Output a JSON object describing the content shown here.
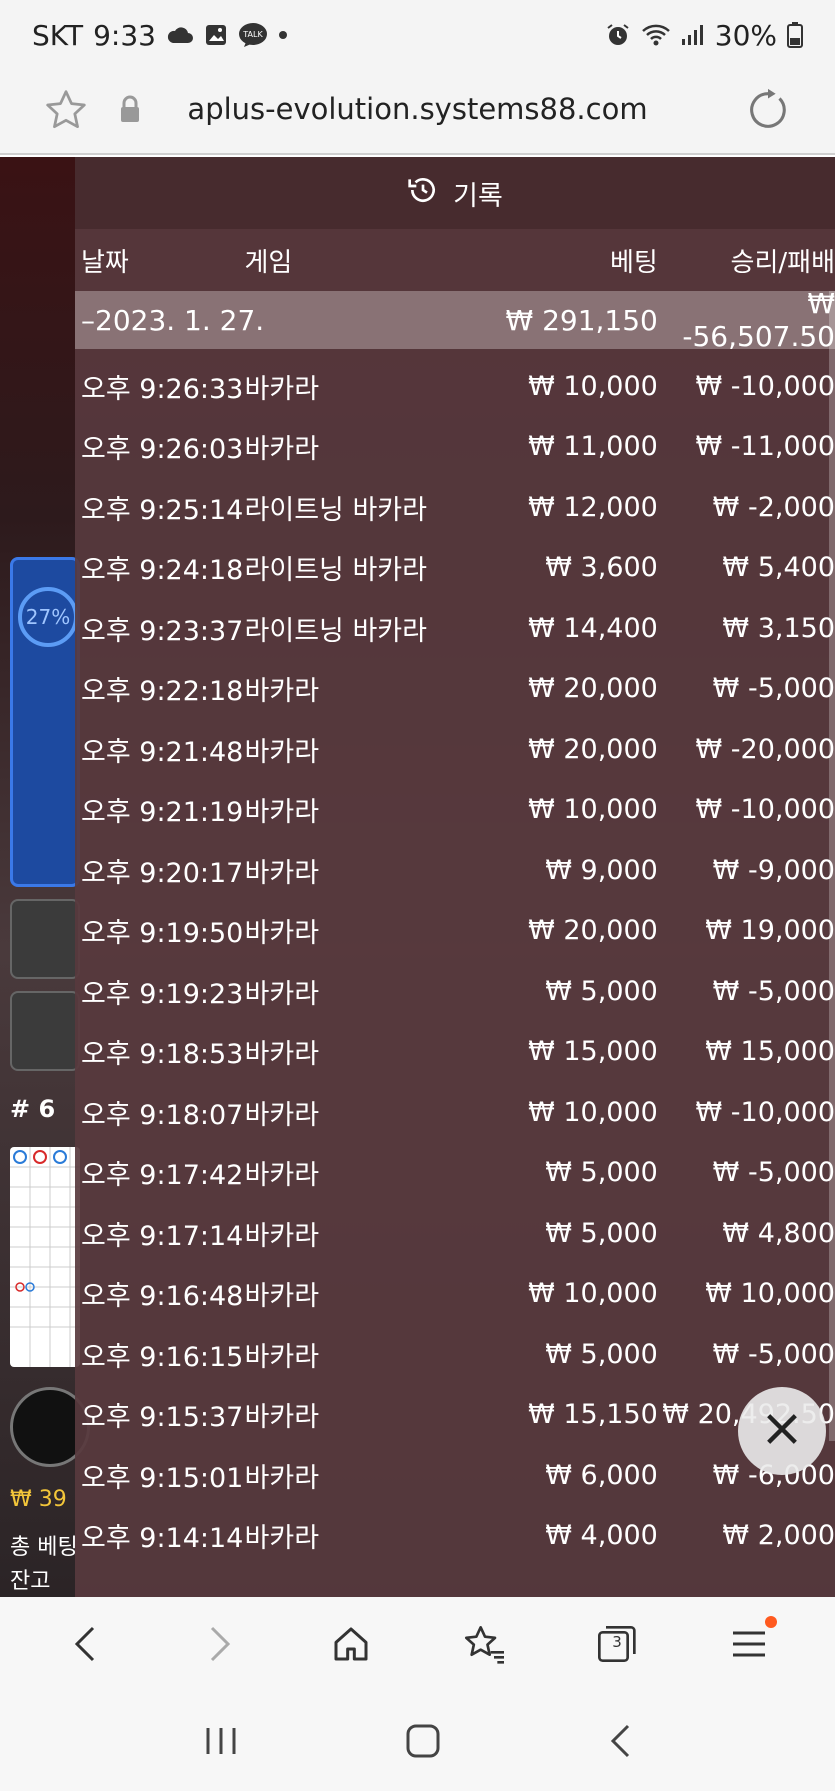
{
  "status_bar": {
    "carrier": "SKT",
    "time": "9:33",
    "battery": "30%",
    "icons_left": [
      "cloud-icon",
      "gallery-icon",
      "talk-icon",
      "dot-icon"
    ],
    "icons_right": [
      "alarm-icon",
      "wifi-icon",
      "signal-icon",
      "battery-icon"
    ]
  },
  "browser": {
    "url": "aplus-evolution.systems88.com"
  },
  "game_background": {
    "progress": "27%",
    "road_number": "# 6",
    "balance_prefix": "₩ 39",
    "total_bet_label": "총 베팅",
    "remaining_label": "잔고"
  },
  "history": {
    "title": "기록",
    "columns": {
      "date": "날짜",
      "game": "게임",
      "bet": "베팅",
      "result": "승리/패배"
    },
    "day": {
      "date": "–2023. 1. 27.",
      "bet": "₩ 291,150",
      "result": "₩ -56,507.50"
    },
    "rows": [
      {
        "time": "오후 9:26:33",
        "game": "바카라",
        "bet": "₩ 10,000",
        "result": "₩ -10,000"
      },
      {
        "time": "오후 9:26:03",
        "game": "바카라",
        "bet": "₩ 11,000",
        "result": "₩ -11,000"
      },
      {
        "time": "오후 9:25:14",
        "game": "라이트닝 바카라",
        "bet": "₩ 12,000",
        "result": "₩ -2,000"
      },
      {
        "time": "오후 9:24:18",
        "game": "라이트닝 바카라",
        "bet": "₩ 3,600",
        "result": "₩ 5,400"
      },
      {
        "time": "오후 9:23:37",
        "game": "라이트닝 바카라",
        "bet": "₩ 14,400",
        "result": "₩ 3,150"
      },
      {
        "time": "오후 9:22:18",
        "game": "바카라",
        "bet": "₩ 20,000",
        "result": "₩ -5,000"
      },
      {
        "time": "오후 9:21:48",
        "game": "바카라",
        "bet": "₩ 20,000",
        "result": "₩ -20,000"
      },
      {
        "time": "오후 9:21:19",
        "game": "바카라",
        "bet": "₩ 10,000",
        "result": "₩ -10,000"
      },
      {
        "time": "오후 9:20:17",
        "game": "바카라",
        "bet": "₩ 9,000",
        "result": "₩ -9,000"
      },
      {
        "time": "오후 9:19:50",
        "game": "바카라",
        "bet": "₩ 20,000",
        "result": "₩ 19,000"
      },
      {
        "time": "오후 9:19:23",
        "game": "바카라",
        "bet": "₩ 5,000",
        "result": "₩ -5,000"
      },
      {
        "time": "오후 9:18:53",
        "game": "바카라",
        "bet": "₩ 15,000",
        "result": "₩ 15,000"
      },
      {
        "time": "오후 9:18:07",
        "game": "바카라",
        "bet": "₩ 10,000",
        "result": "₩ -10,000"
      },
      {
        "time": "오후 9:17:42",
        "game": "바카라",
        "bet": "₩ 5,000",
        "result": "₩ -5,000"
      },
      {
        "time": "오후 9:17:14",
        "game": "바카라",
        "bet": "₩ 5,000",
        "result": "₩ 4,800"
      },
      {
        "time": "오후 9:16:48",
        "game": "바카라",
        "bet": "₩ 10,000",
        "result": "₩ 10,000"
      },
      {
        "time": "오후 9:16:15",
        "game": "바카라",
        "bet": "₩ 5,000",
        "result": "₩ -5,000"
      },
      {
        "time": "오후 9:15:37",
        "game": "바카라",
        "bet": "₩ 15,150",
        "result": "₩ 20,492.50"
      },
      {
        "time": "오후 9:15:01",
        "game": "바카라",
        "bet": "₩ 6,000",
        "result": "₩ -6,000"
      },
      {
        "time": "오후 9:14:14",
        "game": "바카라",
        "bet": "₩ 4,000",
        "result": "₩ 2,000"
      }
    ]
  },
  "bottom_nav": {
    "tabs_count": "3"
  },
  "colors": {
    "overlay": "#583a3e",
    "day_row": "#96828a",
    "accent_notification": "#ff5a1f",
    "balance": "#f3c63a"
  }
}
